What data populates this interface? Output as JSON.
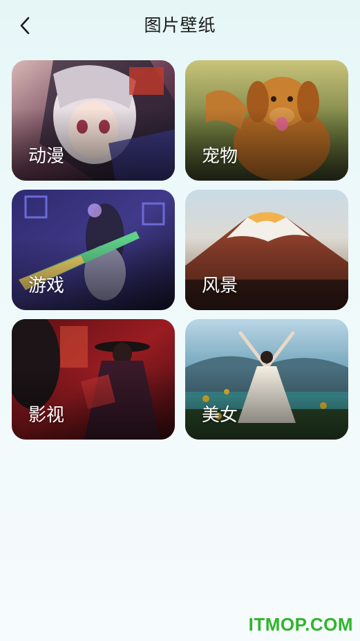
{
  "header": {
    "title": "图片壁纸",
    "back_icon": "chevron-left-icon"
  },
  "categories": [
    {
      "label": "动漫"
    },
    {
      "label": "宠物"
    },
    {
      "label": "游戏"
    },
    {
      "label": "风景"
    },
    {
      "label": "影视"
    },
    {
      "label": "美女"
    }
  ],
  "watermark": "ITMOP.COM",
  "colors": {
    "background": "#e6f6f7",
    "title": "#1a1a1a",
    "watermark": "#2fb52a"
  }
}
